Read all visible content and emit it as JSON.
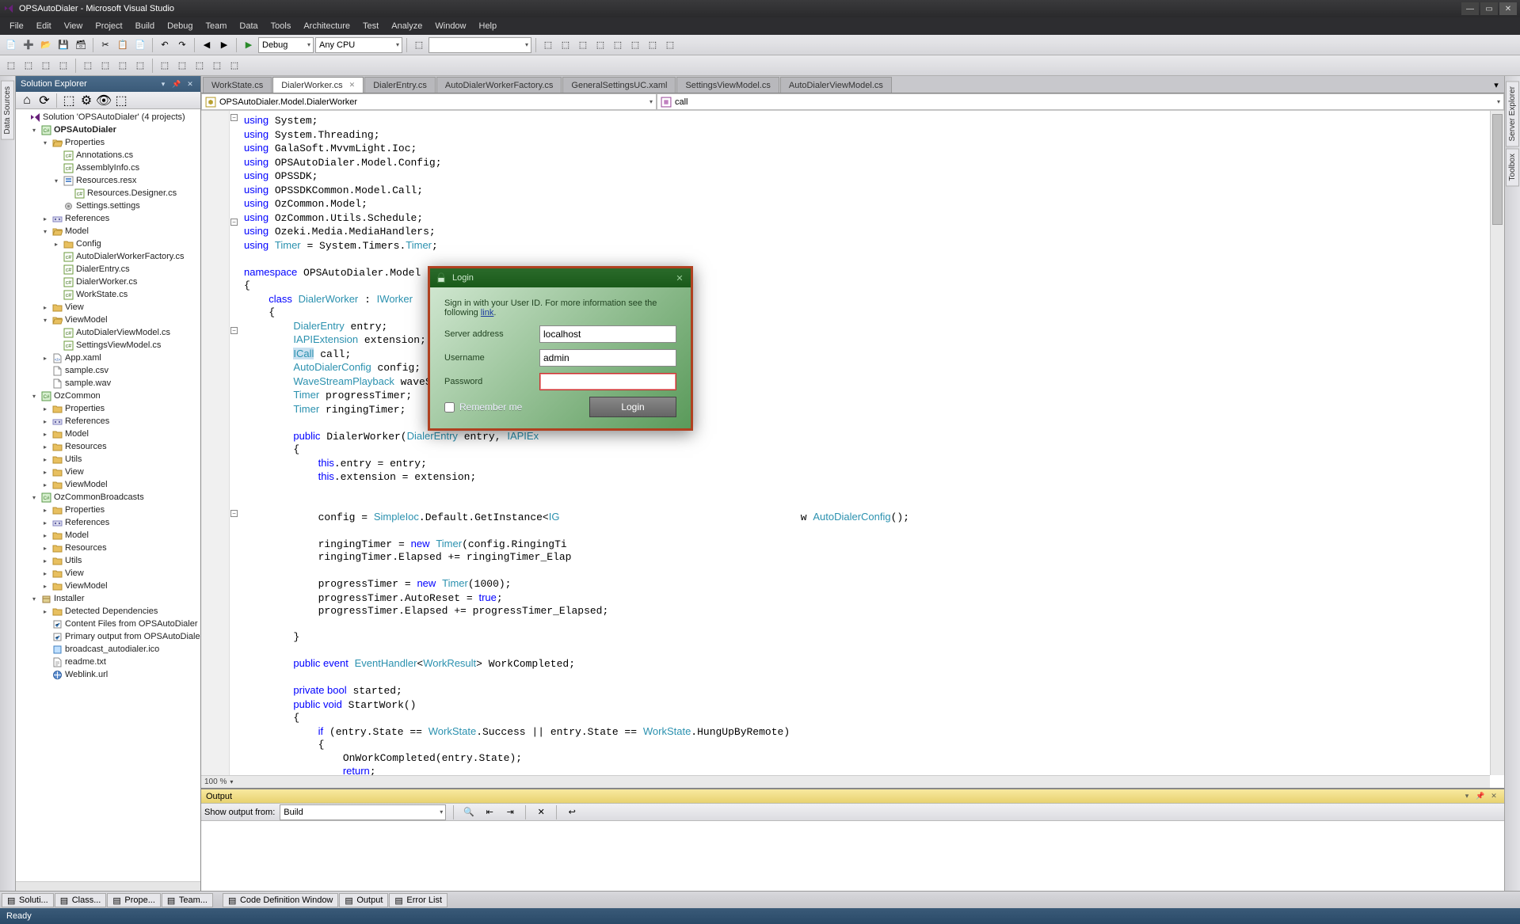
{
  "titlebar": {
    "title": "OPSAutoDialer - Microsoft Visual Studio"
  },
  "menubar": [
    "File",
    "Edit",
    "View",
    "Project",
    "Build",
    "Debug",
    "Team",
    "Data",
    "Tools",
    "Architecture",
    "Test",
    "Analyze",
    "Window",
    "Help"
  ],
  "toolbar": {
    "config_combo": "Debug",
    "platform_combo": "Any CPU",
    "find_combo": ""
  },
  "left_rail": [
    "Data Sources"
  ],
  "right_rail": [
    "Server Explorer",
    "Toolbox"
  ],
  "solution": {
    "panel_title": "Solution Explorer",
    "root": "Solution 'OPSAutoDialer' (4 projects)",
    "tree": [
      {
        "label": "OPSAutoDialer",
        "bold": true,
        "icon": "csproj",
        "exp": "▾",
        "children": [
          {
            "label": "Properties",
            "icon": "folder-open",
            "exp": "▾",
            "children": [
              {
                "label": "Annotations.cs",
                "icon": "cs"
              },
              {
                "label": "AssemblyInfo.cs",
                "icon": "cs"
              },
              {
                "label": "Resources.resx",
                "icon": "resx",
                "exp": "▾",
                "children": [
                  {
                    "label": "Resources.Designer.cs",
                    "icon": "cs"
                  }
                ]
              },
              {
                "label": "Settings.settings",
                "icon": "settings"
              }
            ]
          },
          {
            "label": "References",
            "icon": "refs",
            "exp": "▸"
          },
          {
            "label": "Model",
            "icon": "folder-open",
            "exp": "▾",
            "children": [
              {
                "label": "Config",
                "icon": "folder",
                "exp": "▸"
              },
              {
                "label": "AutoDialerWorkerFactory.cs",
                "icon": "cs"
              },
              {
                "label": "DialerEntry.cs",
                "icon": "cs"
              },
              {
                "label": "DialerWorker.cs",
                "icon": "cs"
              },
              {
                "label": "WorkState.cs",
                "icon": "cs"
              }
            ]
          },
          {
            "label": "View",
            "icon": "folder",
            "exp": "▸"
          },
          {
            "label": "ViewModel",
            "icon": "folder-open",
            "exp": "▾",
            "children": [
              {
                "label": "AutoDialerViewModel.cs",
                "icon": "cs"
              },
              {
                "label": "SettingsViewModel.cs",
                "icon": "cs"
              }
            ]
          },
          {
            "label": "App.xaml",
            "icon": "xaml",
            "exp": "▸"
          },
          {
            "label": "sample.csv",
            "icon": "file"
          },
          {
            "label": "sample.wav",
            "icon": "file"
          }
        ]
      },
      {
        "label": "OzCommon",
        "icon": "csproj",
        "exp": "▾",
        "children": [
          {
            "label": "Properties",
            "icon": "folder",
            "exp": "▸"
          },
          {
            "label": "References",
            "icon": "refs",
            "exp": "▸"
          },
          {
            "label": "Model",
            "icon": "folder",
            "exp": "▸"
          },
          {
            "label": "Resources",
            "icon": "folder",
            "exp": "▸"
          },
          {
            "label": "Utils",
            "icon": "folder",
            "exp": "▸"
          },
          {
            "label": "View",
            "icon": "folder",
            "exp": "▸"
          },
          {
            "label": "ViewModel",
            "icon": "folder",
            "exp": "▸"
          }
        ]
      },
      {
        "label": "OzCommonBroadcasts",
        "icon": "csproj",
        "exp": "▾",
        "children": [
          {
            "label": "Properties",
            "icon": "folder",
            "exp": "▸"
          },
          {
            "label": "References",
            "icon": "refs",
            "exp": "▸"
          },
          {
            "label": "Model",
            "icon": "folder",
            "exp": "▸"
          },
          {
            "label": "Resources",
            "icon": "folder",
            "exp": "▸"
          },
          {
            "label": "Utils",
            "icon": "folder",
            "exp": "▸"
          },
          {
            "label": "View",
            "icon": "folder",
            "exp": "▸"
          },
          {
            "label": "ViewModel",
            "icon": "folder",
            "exp": "▸"
          }
        ]
      },
      {
        "label": "Installer",
        "icon": "installer",
        "exp": "▾",
        "children": [
          {
            "label": "Detected Dependencies",
            "icon": "folder",
            "exp": "▸"
          },
          {
            "label": "Content Files from OPSAutoDialer (Active)",
            "icon": "out"
          },
          {
            "label": "Primary output from OPSAutoDialer (Active)",
            "icon": "out"
          },
          {
            "label": "broadcast_autodialer.ico",
            "icon": "ico"
          },
          {
            "label": "readme.txt",
            "icon": "txt"
          },
          {
            "label": "Weblink.url",
            "icon": "url"
          }
        ]
      }
    ]
  },
  "editor": {
    "tabs": [
      {
        "label": "WorkState.cs"
      },
      {
        "label": "DialerWorker.cs",
        "active": true
      },
      {
        "label": "DialerEntry.cs"
      },
      {
        "label": "AutoDialerWorkerFactory.cs"
      },
      {
        "label": "GeneralSettingsUC.xaml"
      },
      {
        "label": "SettingsViewModel.cs"
      },
      {
        "label": "AutoDialerViewModel.cs"
      }
    ],
    "nav_left": "OPSAutoDialer.Model.DialerWorker",
    "nav_right": "call",
    "zoom": "100 %"
  },
  "output": {
    "title": "Output",
    "show_label": "Show output from:",
    "source": "Build"
  },
  "bottom_tabs": {
    "left": [
      "Soluti...",
      "Class...",
      "Prope...",
      "Team..."
    ],
    "right": [
      "Code Definition Window",
      "Output",
      "Error List"
    ]
  },
  "statusbar": {
    "text": "Ready"
  },
  "login": {
    "title": "Login",
    "intro_pre": "Sign in with your User ID. For more information see the following ",
    "intro_link": "link",
    "intro_post": ".",
    "server_label": "Server address",
    "server_value": "localhost",
    "user_label": "Username",
    "user_value": "admin",
    "pass_label": "Password",
    "pass_value": "",
    "remember_label": "Remember me",
    "login_button": "Login"
  }
}
